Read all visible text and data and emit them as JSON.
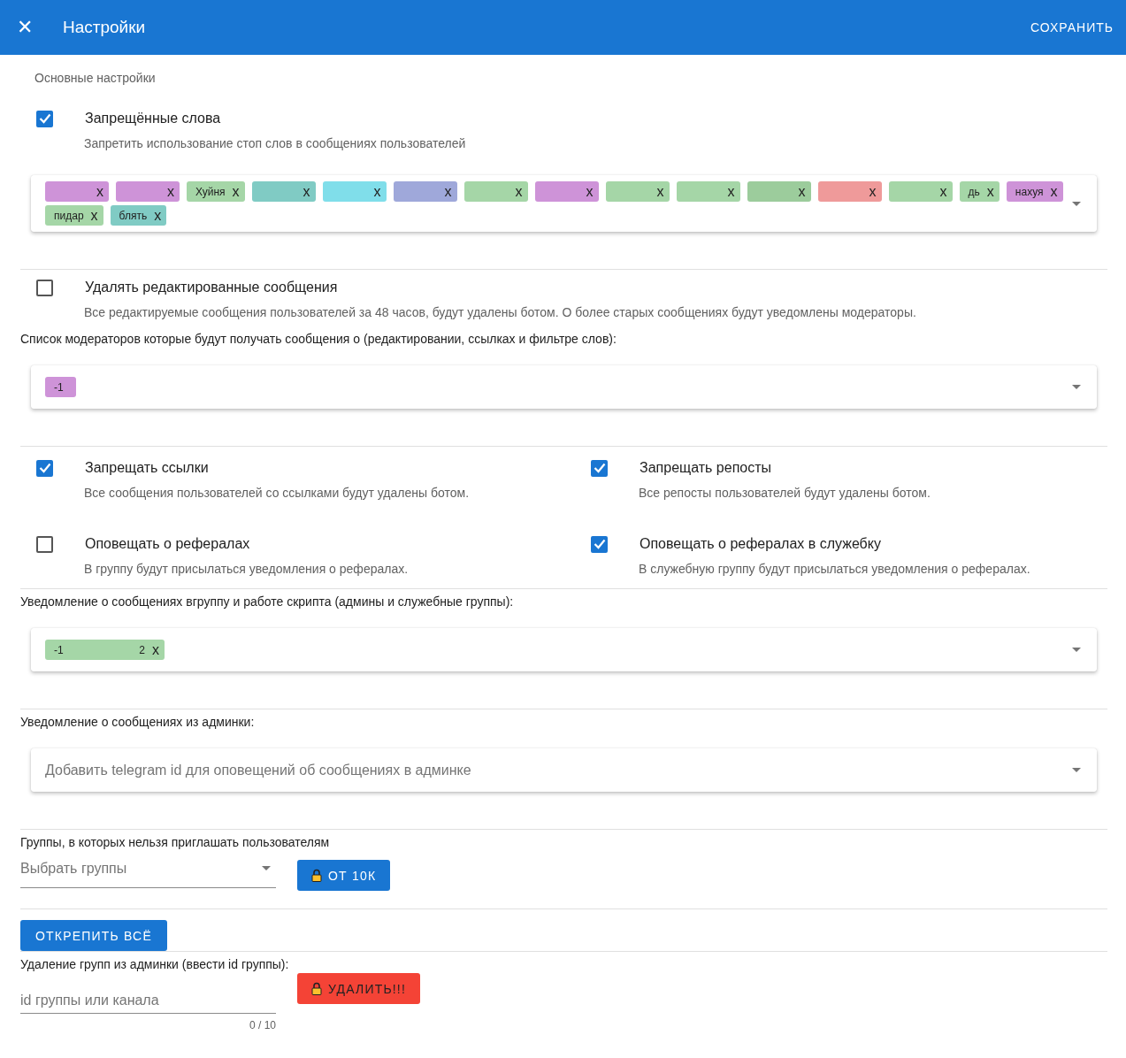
{
  "app_bar": {
    "close_glyph": "✕",
    "title": "Настройки",
    "save_button": "СОХРАНИТЬ"
  },
  "section_title": "Основные настройки",
  "stop_words": {
    "checked": true,
    "label": "Запрещённые слова",
    "description": "Запретить использование стоп слов в сообщениях пользователей",
    "chips": [
      {
        "color": "#ce93d8",
        "close": "x"
      },
      {
        "color": "#ce93d8",
        "close": "x"
      },
      {
        "color": "#a5d6a7",
        "text": "Хуйня",
        "close": "x"
      },
      {
        "color": "#80cbc4",
        "close": "x"
      },
      {
        "color": "#80deea",
        "close": "x"
      },
      {
        "color": "#9fa8da",
        "close": "x"
      },
      {
        "color": "#a5d6a7",
        "close": "x"
      },
      {
        "color": "#ce93d8",
        "close": "x"
      },
      {
        "color": "#a5d6a7",
        "close": "x"
      },
      {
        "color": "#a5d6a7",
        "close": "x"
      },
      {
        "color": "#9ccc9c",
        "close": "x"
      },
      {
        "color": "#ef9a9a",
        "close": "x"
      },
      {
        "color": "#a5d6a7",
        "close": "x"
      },
      {
        "color": "#a5d6a7",
        "text": "дь",
        "close": "x"
      },
      {
        "color": "#ce93d8",
        "text": "нахуя",
        "close": "x"
      },
      {
        "color": "#a5d6a7",
        "text": "пидар",
        "close": "x"
      },
      {
        "color": "#80cbc4",
        "text": "блять",
        "close": "x"
      }
    ]
  },
  "delete_edited": {
    "checked": false,
    "label": "Удалять редактированные сообщения",
    "description": "Все редактируемые сообщения пользователей за 48 часов, будут удалены ботом. О более старых сообщениях будут уведомлены модераторы."
  },
  "moderators": {
    "label": "Список модераторов которые будут получать сообщения о (редактировании, ссылках и фильтре слов):",
    "chips": [
      {
        "color": "#ce93d8",
        "text": "-1"
      }
    ]
  },
  "toggles": [
    {
      "checked": true,
      "label": "Запрещать ссылки",
      "description": "Все сообщения пользователей со ссылками будут удалены ботом."
    },
    {
      "checked": true,
      "label": "Запрещать репосты",
      "description": "Все репосты пользователей будут удалены ботом."
    },
    {
      "checked": false,
      "label": "Оповещать о рефералах",
      "description": "В группу будут присылаться уведомления о рефералах."
    },
    {
      "checked": true,
      "label": "Оповещать о рефералах в служебку",
      "description": "В служебную группу будут присылаться уведомления о рефералах."
    }
  ],
  "group_notify": {
    "label": "Уведомление о сообщениях вгруппу и работе скрипта (админы и служебные группы):",
    "chips": [
      {
        "color": "#a5d6a7",
        "text": "-1",
        "text_end": "2",
        "close": "x"
      }
    ]
  },
  "admin_notify": {
    "label": "Уведомление о сообщениях из админки:",
    "placeholder": "Добавить telegram id для оповещений об сообщениях в админке"
  },
  "no_invite_groups": {
    "label": "Группы, в которых нельзя приглашать пользователям",
    "placeholder": "Выбрать группы",
    "button": "ОТ 10К"
  },
  "unpin_button": "ОТКРЕПИТЬ ВСЁ",
  "remove_groups": {
    "label": "Удаление групп из админки (ввести id группы):",
    "placeholder": "id группы или канала",
    "counter": "0 / 10",
    "button": "УДАЛИТЬ!!!"
  }
}
